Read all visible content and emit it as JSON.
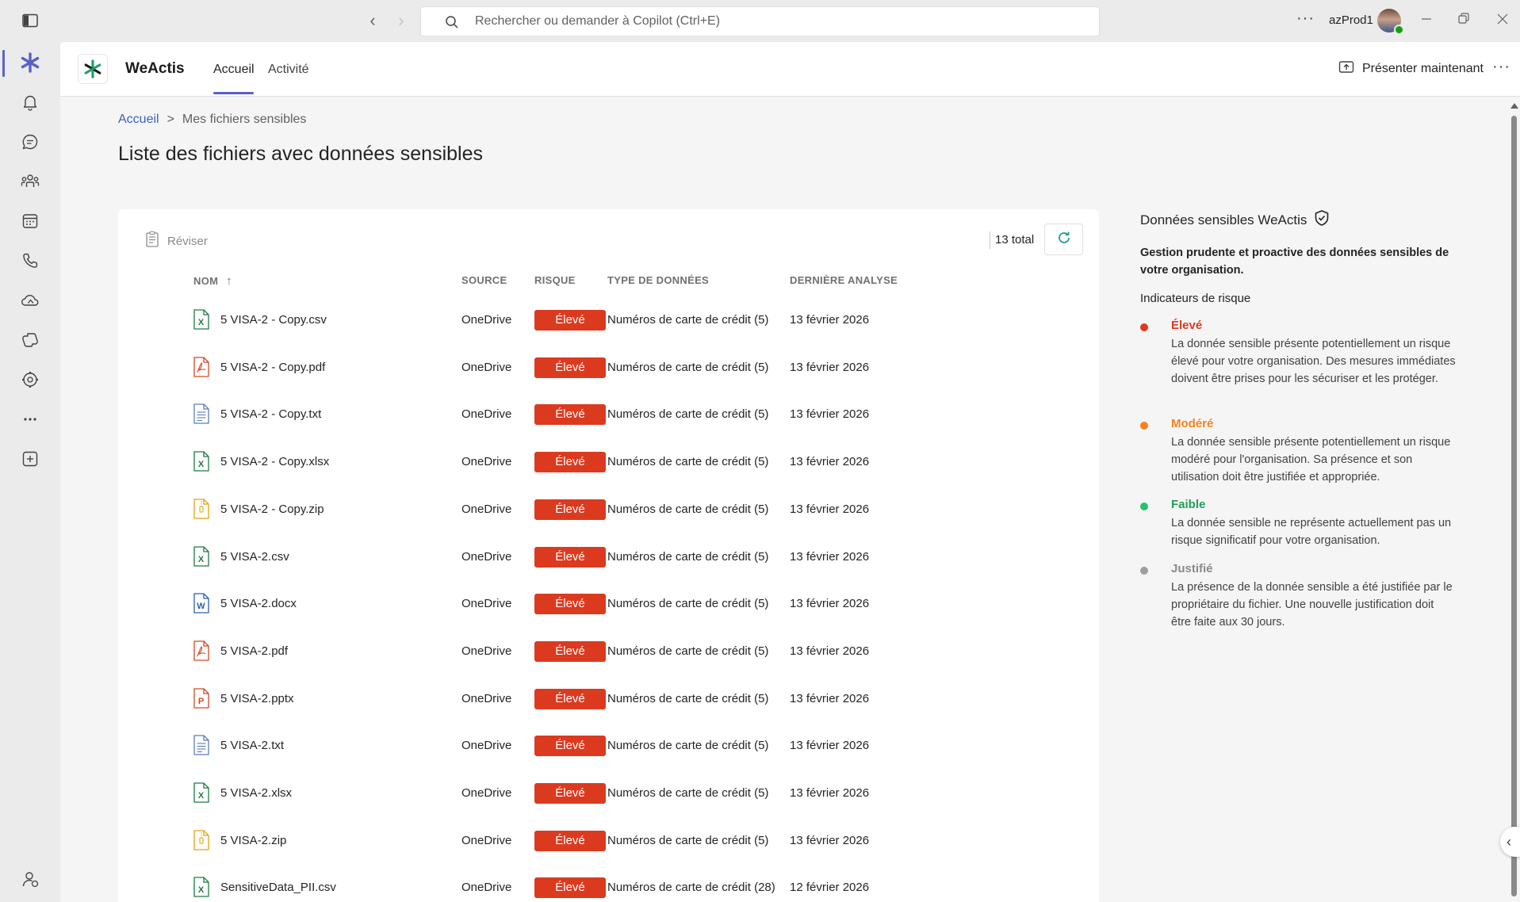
{
  "titlebar": {
    "search_placeholder": "Rechercher ou demander à Copilot (Ctrl+E)",
    "user_name": "azProd1",
    "more_label": "···"
  },
  "rail": {
    "items": [
      "weactis-app-icon",
      "activity-icon",
      "chat-icon",
      "teams-icon",
      "calendar-icon",
      "calls-icon",
      "onedrive-icon",
      "copilot-icon",
      "apps-icon",
      "more-icon",
      "add-app-icon"
    ],
    "bottom": "help-person-icon"
  },
  "header": {
    "app_name": "WeActis",
    "tabs": [
      {
        "label": "Accueil",
        "active": true
      },
      {
        "label": "Activité",
        "active": false
      }
    ],
    "present_label": "Présenter maintenant",
    "more_label": "···"
  },
  "breadcrumb": {
    "home": "Accueil",
    "separator": ">",
    "current": "Mes fichiers sensibles"
  },
  "page_title": "Liste des fichiers avec données sensibles",
  "toolbar": {
    "review_label": "Réviser",
    "total_label": "13 total"
  },
  "table": {
    "columns": {
      "name": "NOM",
      "sort_indicator": "↑",
      "source": "SOURCE",
      "risk": "RISQUE",
      "data_type": "TYPE DE DONNÉES",
      "last_scan": "DERNIÈRE ANALYSE"
    },
    "rows": [
      {
        "icon": "excel",
        "name": "5 VISA-2 - Copy.csv",
        "source": "OneDrive",
        "risk": "Élevé",
        "type": "Numéros de carte de crédit (5)",
        "date": "13 février 2026"
      },
      {
        "icon": "pdf",
        "name": "5 VISA-2 - Copy.pdf",
        "source": "OneDrive",
        "risk": "Élevé",
        "type": "Numéros de carte de crédit (5)",
        "date": "13 février 2026"
      },
      {
        "icon": "txt",
        "name": "5 VISA-2 - Copy.txt",
        "source": "OneDrive",
        "risk": "Élevé",
        "type": "Numéros de carte de crédit (5)",
        "date": "13 février 2026"
      },
      {
        "icon": "excel",
        "name": "5 VISA-2 - Copy.xlsx",
        "source": "OneDrive",
        "risk": "Élevé",
        "type": "Numéros de carte de crédit (5)",
        "date": "13 février 2026"
      },
      {
        "icon": "zip",
        "name": "5 VISA-2 - Copy.zip",
        "source": "OneDrive",
        "risk": "Élevé",
        "type": "Numéros de carte de crédit (5)",
        "date": "13 février 2026"
      },
      {
        "icon": "excel",
        "name": "5 VISA-2.csv",
        "source": "OneDrive",
        "risk": "Élevé",
        "type": "Numéros de carte de crédit (5)",
        "date": "13 février 2026"
      },
      {
        "icon": "word",
        "name": "5 VISA-2.docx",
        "source": "OneDrive",
        "risk": "Élevé",
        "type": "Numéros de carte de crédit (5)",
        "date": "13 février 2026"
      },
      {
        "icon": "pdf",
        "name": "5 VISA-2.pdf",
        "source": "OneDrive",
        "risk": "Élevé",
        "type": "Numéros de carte de crédit (5)",
        "date": "13 février 2026"
      },
      {
        "icon": "powerpoint",
        "name": "5 VISA-2.pptx",
        "source": "OneDrive",
        "risk": "Élevé",
        "type": "Numéros de carte de crédit (5)",
        "date": "13 février 2026"
      },
      {
        "icon": "txt",
        "name": "5 VISA-2.txt",
        "source": "OneDrive",
        "risk": "Élevé",
        "type": "Numéros de carte de crédit (5)",
        "date": "13 février 2026"
      },
      {
        "icon": "excel",
        "name": "5 VISA-2.xlsx",
        "source": "OneDrive",
        "risk": "Élevé",
        "type": "Numéros de carte de crédit (5)",
        "date": "13 février 2026"
      },
      {
        "icon": "zip",
        "name": "5 VISA-2.zip",
        "source": "OneDrive",
        "risk": "Élevé",
        "type": "Numéros de carte de crédit (5)",
        "date": "13 février 2026"
      },
      {
        "icon": "excel",
        "name": "SensitiveData_PII.csv",
        "source": "OneDrive",
        "risk": "Élevé",
        "type": "Numéros de carte de crédit (28)",
        "date": "12 février 2026"
      }
    ]
  },
  "panel": {
    "title": "Données sensibles WeActis",
    "subtitle": "Gestion prudente et proactive des données sensibles de votre organisation.",
    "indicators_title": "Indicateurs de risque",
    "indicators": [
      {
        "label": "Élevé",
        "color": "#dc3a1f",
        "description": "La donnée sensible présente potentiellement un risque élevé pour votre organisation. Des mesures immédiates doivent être prises pour les sécuriser et les protéger."
      },
      {
        "label": "Modéré",
        "color": "#f7811d",
        "description": "La donnée sensible présente potentiellement un risque modéré pour l'organisation. Sa présence et son utilisation doit être justifiée et appropriée."
      },
      {
        "label": "Faible",
        "color": "#23c36b",
        "description": "La donnée sensible ne représente actuellement pas un risque significatif pour votre organisation."
      },
      {
        "label": "Justifié",
        "color": "#9e9e9e",
        "description": "La présence de la donnée sensible a été justifiée par le propriétaire du fichier. Une nouvelle justification doit être faite aux 30 jours."
      }
    ]
  },
  "colors": {
    "accent": "#5b5fc7",
    "risk_high": "#dc3a1f",
    "link": "#3a63b8"
  }
}
